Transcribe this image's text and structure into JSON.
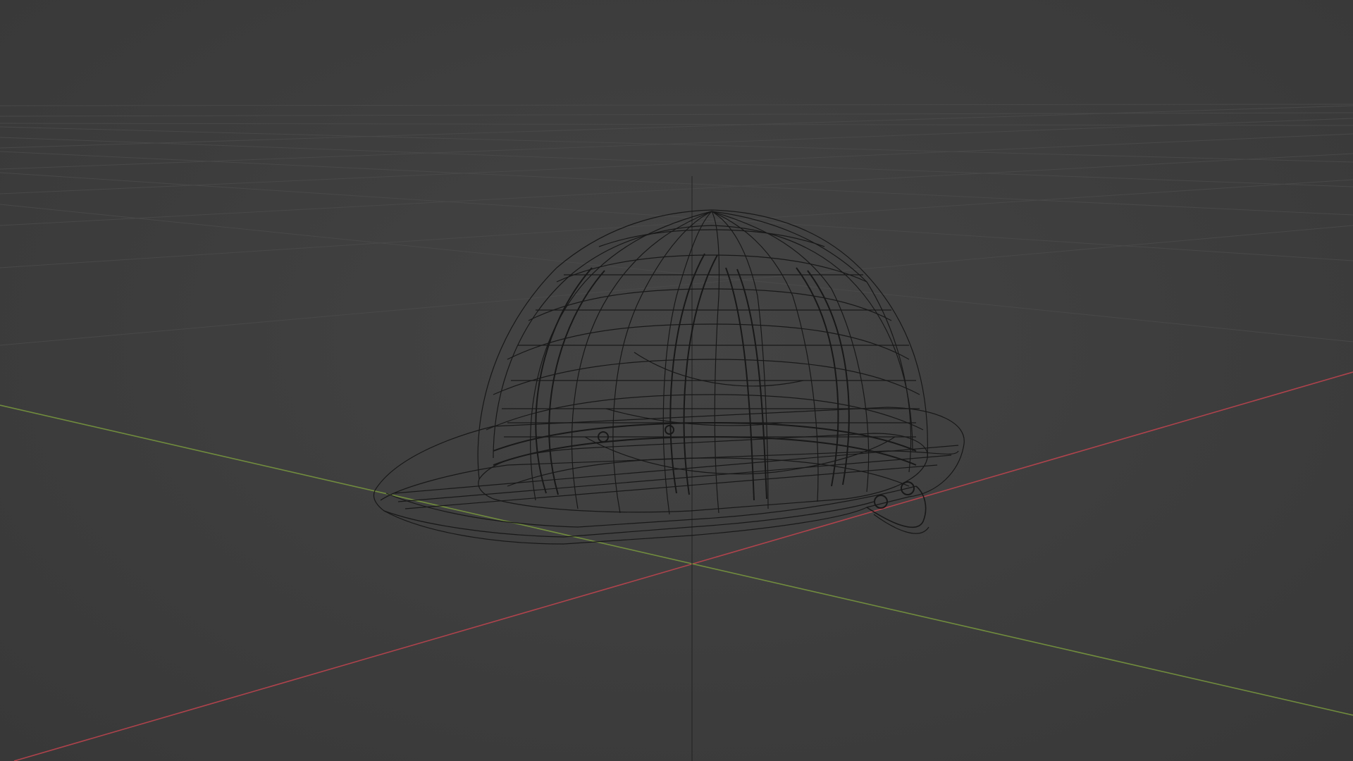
{
  "viewport": {
    "background_color": "#3d3d3d",
    "grid_color": "#4a4a4a",
    "x_axis_color": "#c2444f",
    "y_axis_color": "#7a9a3e",
    "z_axis_color": "#2a2a2a",
    "wire_color": "#141414",
    "shading_mode": "wireframe",
    "object_icon": "hard-hat-wireframe"
  }
}
